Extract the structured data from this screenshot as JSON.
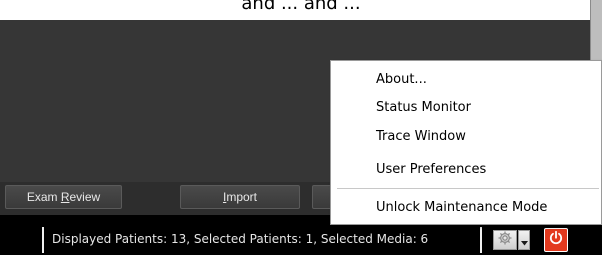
{
  "partial_top_text": "and ... and ...",
  "buttons": {
    "exam_review": {
      "pre": "Exam ",
      "key": "R",
      "post": "eview"
    },
    "import": {
      "pre": "",
      "key": "I",
      "post": "mport"
    }
  },
  "status": {
    "text": "Displayed Patients: 13, Selected Patients: 1, Selected Media: 6"
  },
  "menu": {
    "items": [
      "About...",
      "Status Monitor",
      "Trace Window",
      "User Preferences",
      "Unlock Maintenance Mode"
    ]
  },
  "icons": {
    "settings": "gear-icon",
    "dropdown": "chevron-down-icon",
    "power": "power-icon"
  },
  "colors": {
    "main_background": "#363636",
    "status_bar": "#000000",
    "power_button": "#e33a1f"
  }
}
